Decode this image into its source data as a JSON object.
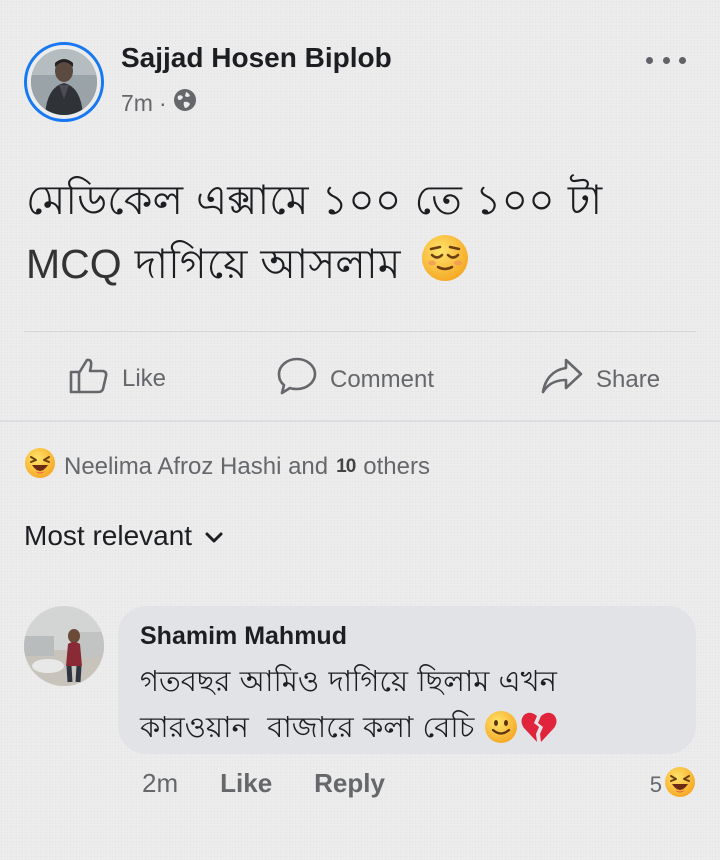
{
  "post": {
    "author": "Sajjad Hosen Biplob",
    "time": "7m",
    "separator": "·",
    "audience_icon": "globe-icon",
    "text_line1": "মেডিকেল এক্সামে ১০০ তে ১০০ টা",
    "text_line2_latin": "MCQ",
    "text_line2_bengali": "দাগিয়ে আসলাম",
    "emoji": "relieved-face-icon"
  },
  "actions": {
    "like": "Like",
    "comment": "Comment",
    "share": "Share"
  },
  "reactions": {
    "emoji": "laughing-face-icon",
    "text": "Neelima Afroz Hashi and",
    "count": "10",
    "suffix": "others"
  },
  "sort": {
    "label": "Most relevant"
  },
  "comment": {
    "author": "Shamim Mahmud",
    "text_line1": "গতবছর আমিও দাগিয়ে ছিলাম এখন",
    "text_line2": "কারওয়ান  বাজারে কলা বেচি",
    "emojis": [
      "slightly-smiling-face-icon",
      "broken-heart-icon"
    ],
    "time": "2m",
    "like": "Like",
    "reply": "Reply",
    "reaction_count": "5",
    "reaction_emoji": "laughing-face-icon"
  },
  "colors": {
    "accent": "#1877f2",
    "secondary_text": "#65676b",
    "bubble": "#e2e3e6"
  }
}
